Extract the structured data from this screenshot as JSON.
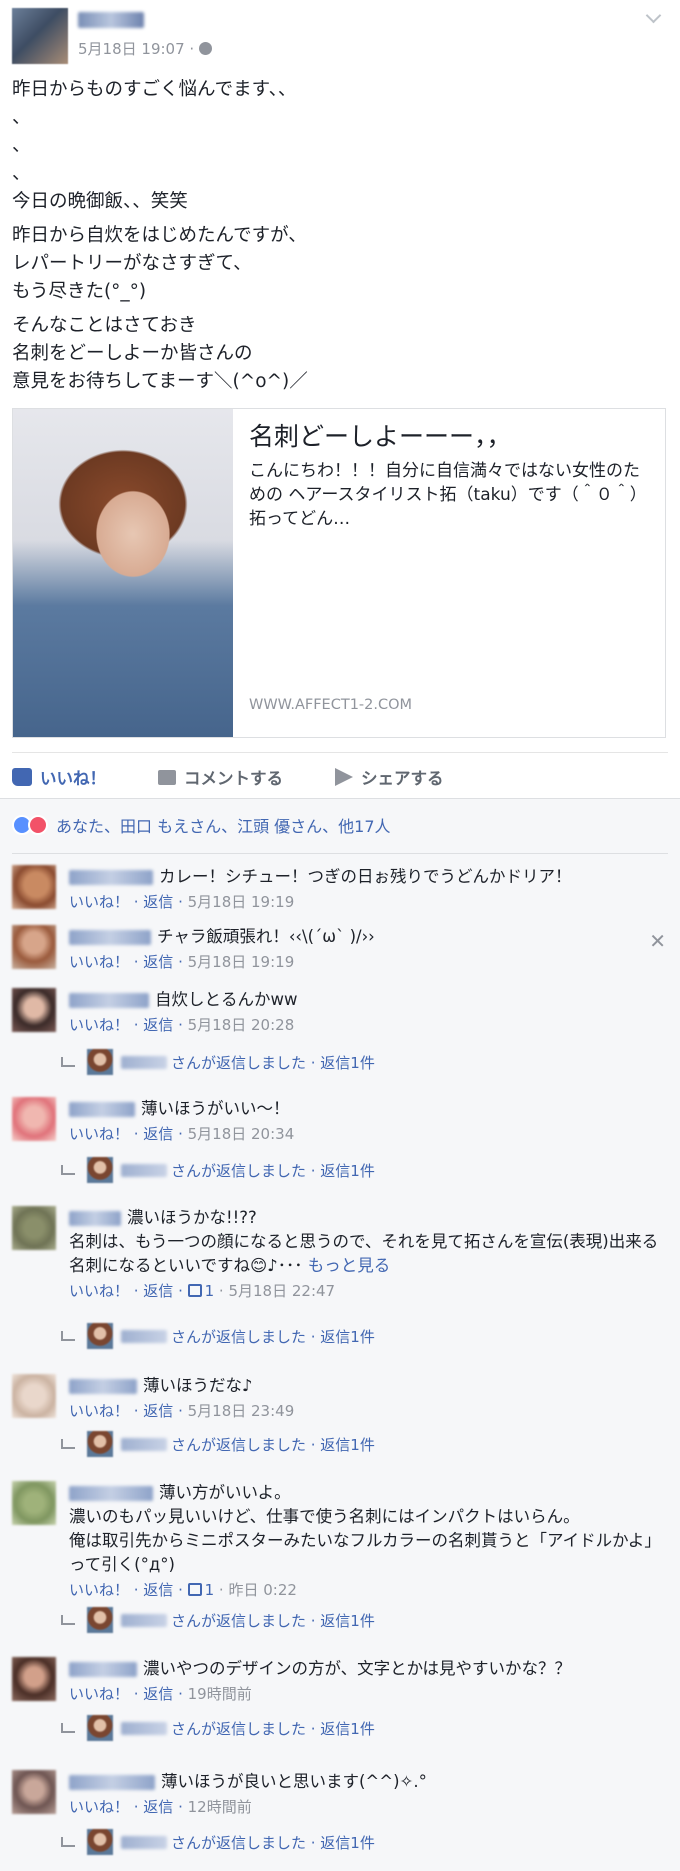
{
  "post": {
    "author_name": "",
    "timestamp": "5月18日 19:07 ·",
    "privacy_icon": "globe-icon",
    "body_paragraphs": [
      "昨日からものすごく悩んでます、、\n、\n、\n、\n今日の晩御飯、、笑笑",
      "昨日から自炊をはじめたんですが、\nレパートリーがなさすぎて、\nもう尽きた(°_°)",
      "そんなことはさておき\n名刺をどーしよーか皆さんの\n意見をお待ちしてまーす＼(^o^)／"
    ],
    "link": {
      "title": "名刺どーしよーーー，，",
      "description": "こんにちわ！！！自分に自信満々ではない女性のための ヘアースタイリスト拓（taku）です（＾０＾） 拓ってどん…",
      "domain": "WWW.AFFECT1-2.COM"
    }
  },
  "actions": {
    "like": "いいね！",
    "comment": "コメントする",
    "share": "シェアする"
  },
  "reactions": {
    "text": "あなた、田口 もえさん、江頭 優さん、他17人"
  },
  "comments": [
    {
      "text": "カレー！シチュー！つぎの日ぉ残りでうどんかドリア！",
      "meta": "いいね！ · 返信 · ",
      "time": "5月18日 19:19"
    },
    {
      "text": "チャラ飯頑張れ！‹‹\\(´ω` )/››",
      "meta": "いいね！ · 返信 · ",
      "time": "5月18日 19:19"
    },
    {
      "text": "自炊しとるんかww",
      "meta": "いいね！ · 返信 · ",
      "time": "5月18日 20:28",
      "reply": "さんが返信しました · 返信1件"
    },
    {
      "text": "薄いほうがいい〜！",
      "meta": "いいね！ · 返信 · ",
      "time": "5月18日 20:34",
      "reply": "さんが返信しました · 返信1件"
    },
    {
      "text": "濃いほうかな!!??\n名刺は、もう一つの顔になると思うので、それを見て拓さんを宣伝(表現)出来る名刺になるといいですね😊♪･･･",
      "more": "もっと見る",
      "meta": "いいね！ · 返信 · ",
      "likes": "1",
      "time": " · 5月18日 22:47",
      "reply": "さんが返信しました · 返信1件"
    },
    {
      "text": "薄いほうだな♪",
      "meta": "いいね！ · 返信 · ",
      "time": "5月18日 23:49",
      "reply": "さんが返信しました · 返信1件"
    },
    {
      "text": "薄い方がいいよ。\n濃いのもパッ見いいけど、仕事で使う名刺にはインパクトはいらん。\n俺は取引先からミニポスターみたいなフルカラーの名刺貰うと「アイドルかよ」って引く(°д°)",
      "meta": "いいね！ · 返信 · ",
      "likes": "1",
      "time": " · 昨日 0:22",
      "reply": "さんが返信しました · 返信1件"
    },
    {
      "text": "濃いやつのデザインの方が、文字とかは見やすいかな？？",
      "meta": "いいね！ · 返信 · ",
      "time": "19時間前",
      "reply": "さんが返信しました · 返信1件"
    },
    {
      "text": "薄いほうが良いと思います(^^)✧.°",
      "meta": "いいね！ · 返信 · ",
      "time": "12時間前",
      "reply": "さんが返信しました · 返信1件"
    }
  ],
  "colors": {
    "link_blue": "#4267b2",
    "meta_gray": "#90949c",
    "comment_bg": "#f6f7f9"
  }
}
